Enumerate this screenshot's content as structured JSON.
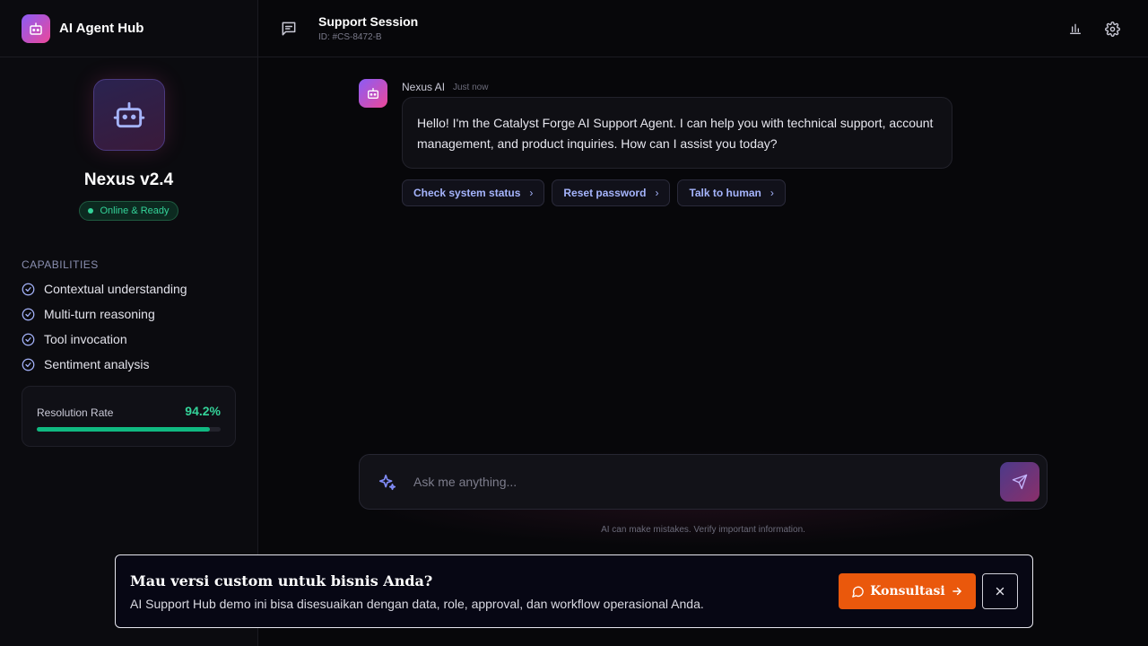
{
  "brand": {
    "title": "AI Agent Hub",
    "icon": "bot-icon",
    "accent": "#8b5cf6"
  },
  "agent": {
    "name": "Nexus v2.4",
    "status": "Online & Ready",
    "status_color": "#34d399",
    "capabilities_title": "CAPABILITIES",
    "capabilities": [
      "Contextual understanding",
      "Multi-turn reasoning",
      "Tool invocation",
      "Sentiment analysis"
    ],
    "resolution": {
      "label": "Resolution Rate",
      "value": "94.2%",
      "fraction": 0.942
    }
  },
  "header": {
    "icon": "chat-bubble-icon",
    "title": "Support Session",
    "session_id": "ID: #CS-8472-B",
    "actions": [
      "bar-chart-icon",
      "gear-icon"
    ]
  },
  "chat": {
    "messages": [
      {
        "author": "Nexus AI",
        "time": "Just now",
        "text": "Hello! I'm the Catalyst Forge AI Support Agent. I can help you with technical support, account management, and product inquiries. How can I assist you today?"
      }
    ],
    "quick_replies": [
      "Check system status",
      "Reset password",
      "Talk to human"
    ]
  },
  "composer": {
    "placeholder": "Ask me anything...",
    "value": "",
    "disclaimer": "AI can make mistakes. Verify important information."
  },
  "banner": {
    "title": "Mau versi custom untuk bisnis Anda?",
    "subtitle": "AI Support Hub demo ini bisa disesuaikan dengan data, role, approval, dan workflow operasional Anda.",
    "cta_label": "Konsultasi",
    "cta_color": "#ea580c"
  }
}
